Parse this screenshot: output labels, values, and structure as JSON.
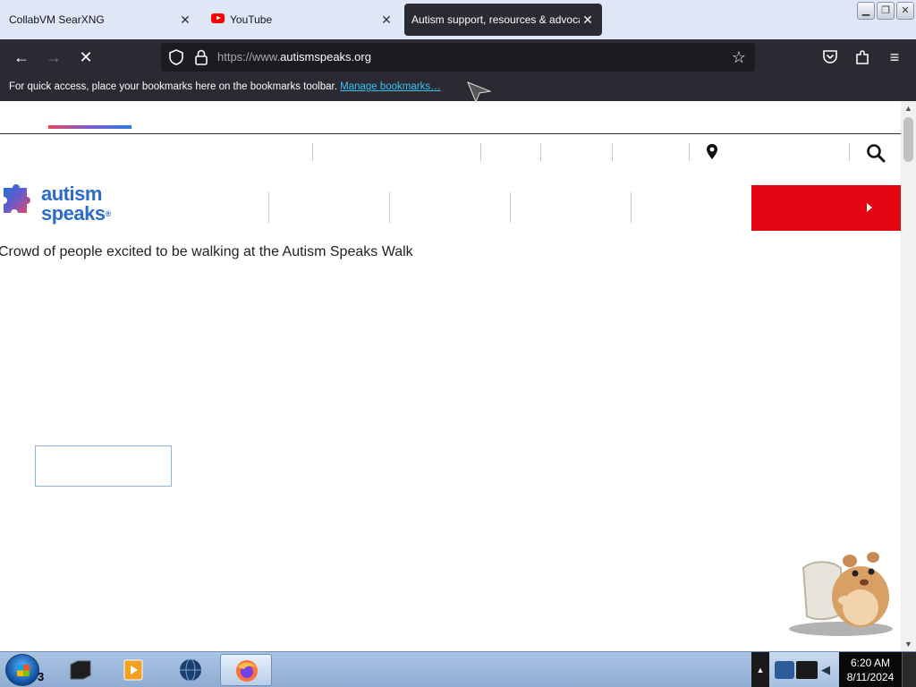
{
  "browser": {
    "tabs": [
      {
        "title": "CollabVM SearXNG",
        "active": false
      },
      {
        "title": "YouTube",
        "active": false,
        "icon": "youtube-icon"
      },
      {
        "title": "Autism support, resources & advocacy",
        "active": true
      }
    ],
    "url_prefix": "https://www.",
    "url_domain": "autismspeaks.org",
    "bookmarks_text": "For quick access, place your bookmarks here on the bookmarks toolbar.",
    "bookmarks_link": "Manage bookmarks…"
  },
  "page": {
    "logo_line1": "autism",
    "logo_line2": "speaks",
    "logo_mark": "®",
    "hero_alt_text": "Crowd of people excited to be walking at the Autism Speaks Walk",
    "colors": {
      "brand_blue": "#2a6bcc",
      "donate_red": "#e30613"
    }
  },
  "taskbar": {
    "orb_label": "3",
    "clock_time": "6:20 AM",
    "clock_date": "8/11/2024"
  }
}
